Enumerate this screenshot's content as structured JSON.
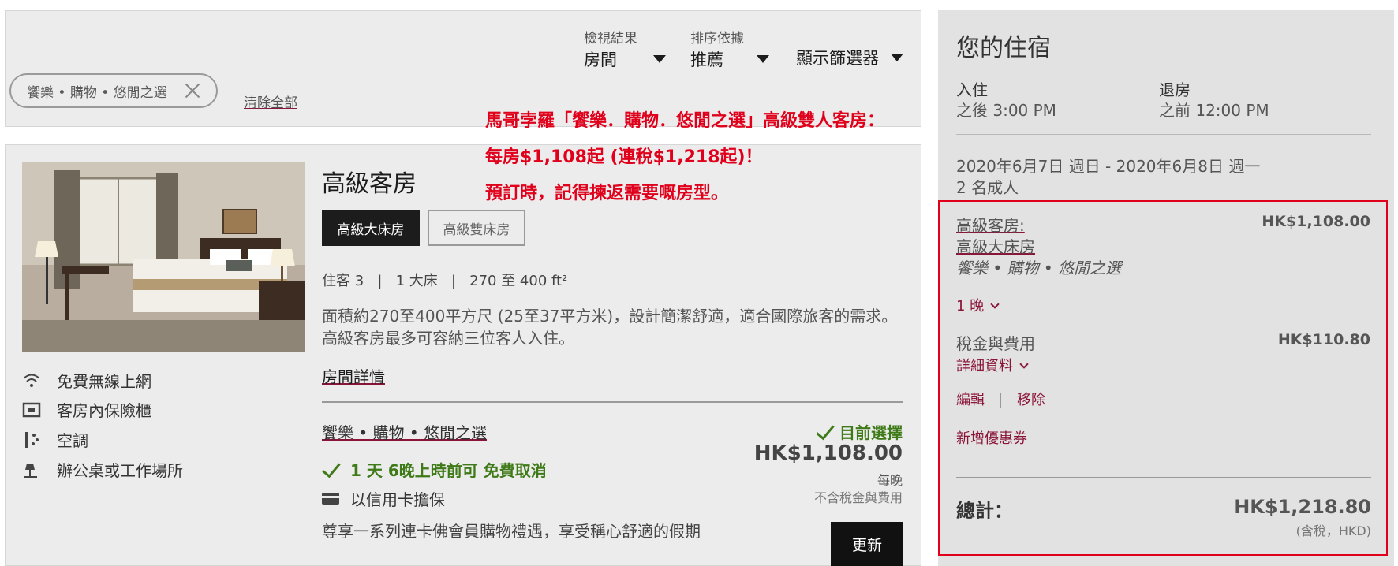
{
  "filters": {
    "view": {
      "label": "檢視結果",
      "value": "房間"
    },
    "sort": {
      "label": "排序依據",
      "value": "推薦"
    },
    "show_filters": "顯示篩選器",
    "chip": "饗樂 • 購物 • 悠閒之選",
    "clear_all": "清除全部"
  },
  "promo": {
    "line1": "馬哥孛羅「饗樂．購物．悠閒之選」高級雙人客房：",
    "line2": "每房$1,108起 (連稅$1,218起)！",
    "line3": "預訂時，記得揀返需要嘅房型。"
  },
  "room": {
    "title": "高級客房",
    "bed_options": [
      "高級大床房",
      "高級雙床房"
    ],
    "selected_bed": "高級大床房",
    "specs": "住客 3   |   1 大床   |   270 至 400 ft²",
    "description": "面積約270至400平方尺 (25至37平方米)，設計簡潔舒適，適合國際旅客的需求。高級客房最多可容納三位客人入住。",
    "details_link": "房間詳情",
    "amenities": [
      {
        "icon": "wifi-icon",
        "label": "免費無線上網"
      },
      {
        "icon": "safe-icon",
        "label": "客房內保險櫃"
      },
      {
        "icon": "air-conditioning-icon",
        "label": "空調"
      },
      {
        "icon": "desk-lamp-icon",
        "label": "辦公桌或工作場所"
      }
    ]
  },
  "rate": {
    "name": "饗樂 • 購物 • 悠閒之選",
    "cancellation": "1 天 6晚上時前可 免費取消",
    "guarantee": "以信用卡擔保",
    "benefit": "尊享一系列連卡佛會員購物禮遇，享受稱心舒適的假期",
    "selected_label": "目前選擇",
    "price": "HK$1,108.00",
    "per_night": "每晚",
    "excl_tax": "不含稅金與費用",
    "update_button": "更新"
  },
  "summary": {
    "title": "您的住宿",
    "checkin_label": "入住",
    "checkin_value": "之後 3:00 PM",
    "checkout_label": "退房",
    "checkout_value": "之前 12:00 PM",
    "dates": "2020年6月7日 週日 - 2020年6月8日 週一",
    "guests": "2 名成人",
    "room_type_line1": "高級客房:",
    "room_type_line2": "高級大床房",
    "rate_name": "饗樂 • 購物 • 悠閒之選",
    "room_price": "HK$1,108.00",
    "nights": "1 晚",
    "taxes_label": "稅金與費用",
    "taxes_value": "HK$110.80",
    "details_link": "詳細資料",
    "edit": "編輯",
    "remove": "移除",
    "add_promo": "新增優惠券",
    "total_label": "總計：",
    "total_value": "HK$1,218.80",
    "total_note": "(含稅，HKD)"
  },
  "colors": {
    "accent": "#8a1538",
    "promo_red": "#e0001b",
    "success_green": "#3f7a18",
    "panel_grey": "#ececec"
  }
}
